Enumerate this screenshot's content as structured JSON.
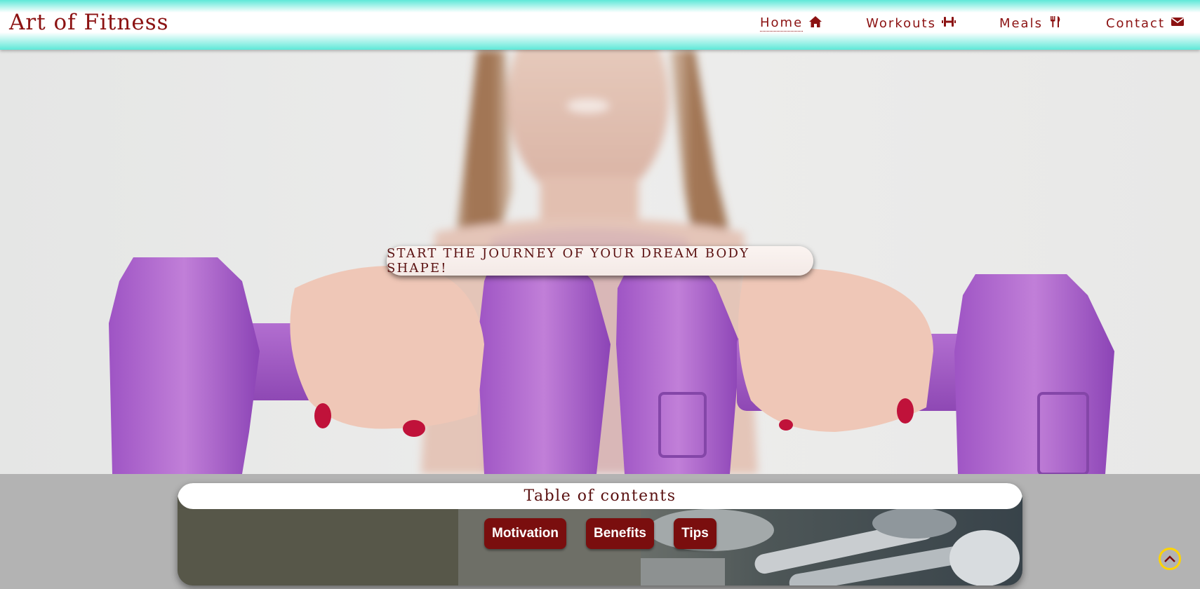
{
  "header": {
    "brand": "Art of Fitness",
    "nav": [
      {
        "label": "Home",
        "icon": "home-icon",
        "active": true
      },
      {
        "label": "Workouts",
        "icon": "dumbbell-icon",
        "active": false
      },
      {
        "label": "Meals",
        "icon": "utensils-icon",
        "active": false
      },
      {
        "label": "Contact",
        "icon": "envelope-icon",
        "active": false
      }
    ]
  },
  "hero": {
    "tagline": "START THE JOURNEY OF YOUR DREAM BODY SHAPE!"
  },
  "toc": {
    "title": "Table of contents",
    "buttons": [
      "Motivation",
      "Benefits",
      "Tips"
    ]
  },
  "colors": {
    "brand": "#8b1212",
    "header_accent": "#5ee8d8",
    "button_bg": "#7a0e0e",
    "scroll_top": "#ffd400"
  },
  "scroll_top": {
    "icon": "chevron-up-icon"
  }
}
